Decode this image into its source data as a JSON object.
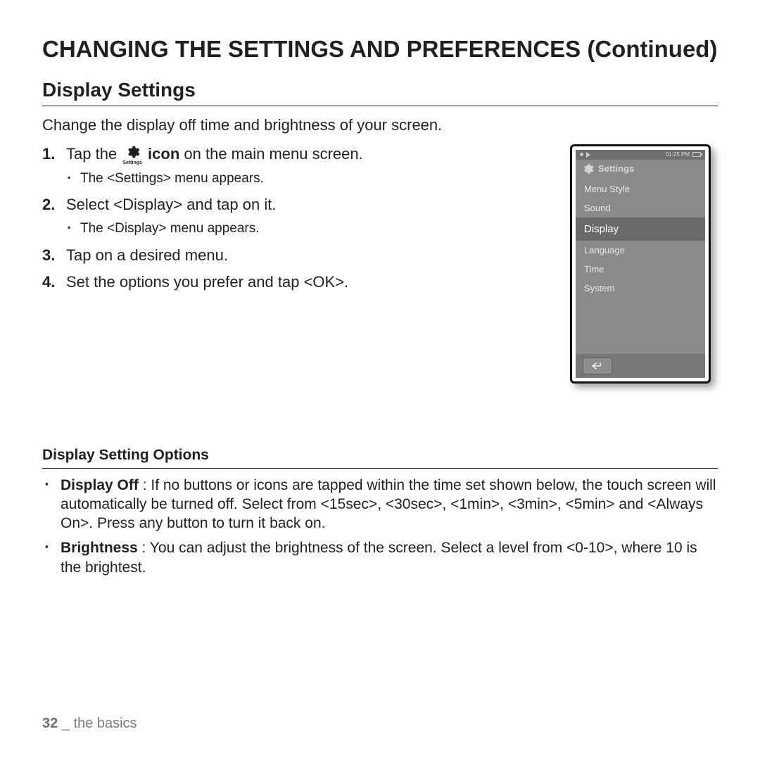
{
  "page": {
    "title": "CHANGING THE SETTINGS AND PREFERENCES (Continued)",
    "section_title": "Display Settings",
    "intro": "Change the display off time and brightness of your screen."
  },
  "steps": [
    {
      "pre": "Tap the ",
      "icon_caption": "Settings",
      "post_bold": "icon",
      "post": " on the main menu screen.",
      "sub": "The <Settings> menu appears."
    },
    {
      "line_pre": "Select ",
      "line_bold": "<Display>",
      "line_post": " and tap on it.",
      "sub": "The <Display> menu appears."
    },
    {
      "line": "Tap on a desired menu."
    },
    {
      "line_pre": "Set the options you prefer and tap ",
      "line_bold": "<OK>",
      "line_post": "."
    }
  ],
  "device": {
    "status_time": "01:25 PM",
    "header": "Settings",
    "menu": [
      "Menu Style",
      "Sound",
      "Display",
      "Language",
      "Time",
      "System"
    ],
    "selected_index": 2
  },
  "options": {
    "title": "Display Setting Options",
    "items": [
      {
        "label": "Display Off",
        "text": " : If no buttons or icons are tapped within the time set shown below, the touch screen will automatically be turned off. Select from <15sec>, <30sec>, <1min>, <3min>, <5min> and <Always On>. Press any button to turn it back on."
      },
      {
        "label": "Brightness",
        "text": " : You can adjust the brightness of the screen. Select a level from <0-10>, where 10 is the brightest."
      }
    ]
  },
  "footer": {
    "page_number": "32",
    "sep": " _ ",
    "chapter": "the basics"
  }
}
